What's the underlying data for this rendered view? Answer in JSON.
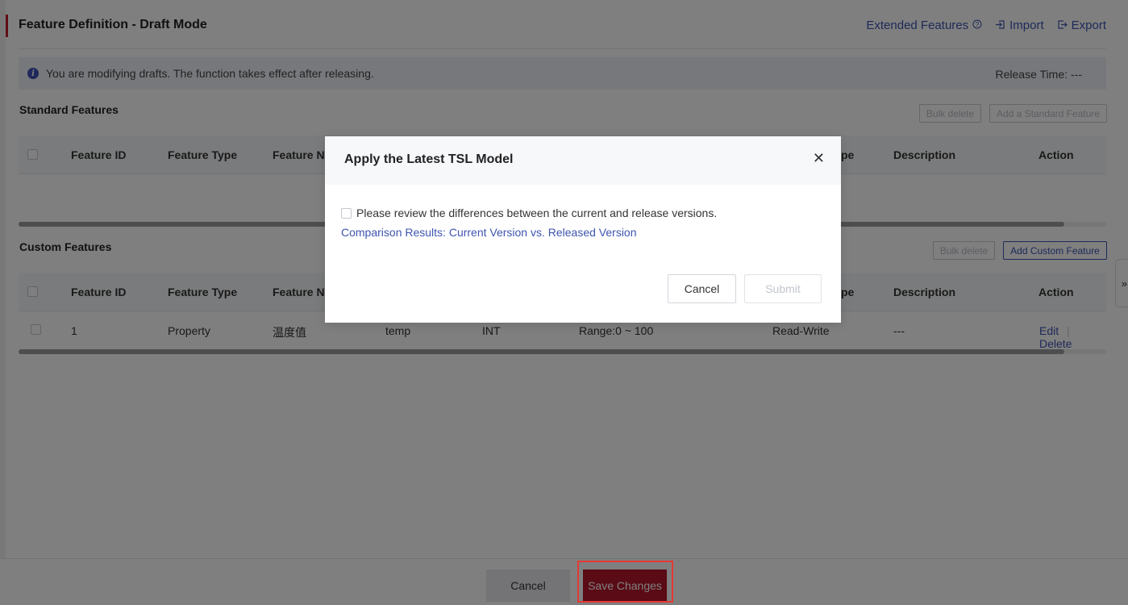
{
  "header": {
    "title": "Feature Definition - Draft Mode",
    "links": {
      "extended": "Extended Features",
      "help_icon": "help-circle-icon",
      "import": "Import",
      "import_icon": "import-icon",
      "export": "Export",
      "export_icon": "export-icon"
    }
  },
  "info": {
    "message": "You are modifying drafts. The function takes effect after releasing.",
    "release_label": "Release Time:",
    "release_value": "---"
  },
  "standard": {
    "title": "Standard Features",
    "bulk_delete": "Bulk delete",
    "add_button": "Add a Standard Feature"
  },
  "custom": {
    "title": "Custom Features",
    "bulk_delete": "Bulk delete",
    "add_button": "Add Custom Feature"
  },
  "columns": {
    "id": "Feature ID",
    "type": "Feature Type",
    "name": "Feature Na",
    "rw_tail": "pe",
    "description": "Description",
    "action": "Action"
  },
  "rows": [
    {
      "id": "1",
      "type": "Property",
      "name": "温度值",
      "identifier": "temp",
      "data_type": "INT",
      "range": "Range:0 ~ 100",
      "rw": "Read-Write",
      "description": "---",
      "edit": "Edit",
      "sep": "|",
      "delete": "Delete"
    }
  ],
  "side_tab": "»",
  "footer": {
    "cancel": "Cancel",
    "save": "Save Changes"
  },
  "modal": {
    "title": "Apply the Latest TSL Model",
    "close": "✕",
    "review_text": "Please review the differences between the current and release versions.",
    "link_text": "Comparison Results: Current Version vs. Released Version",
    "cancel": "Cancel",
    "submit": "Submit"
  }
}
